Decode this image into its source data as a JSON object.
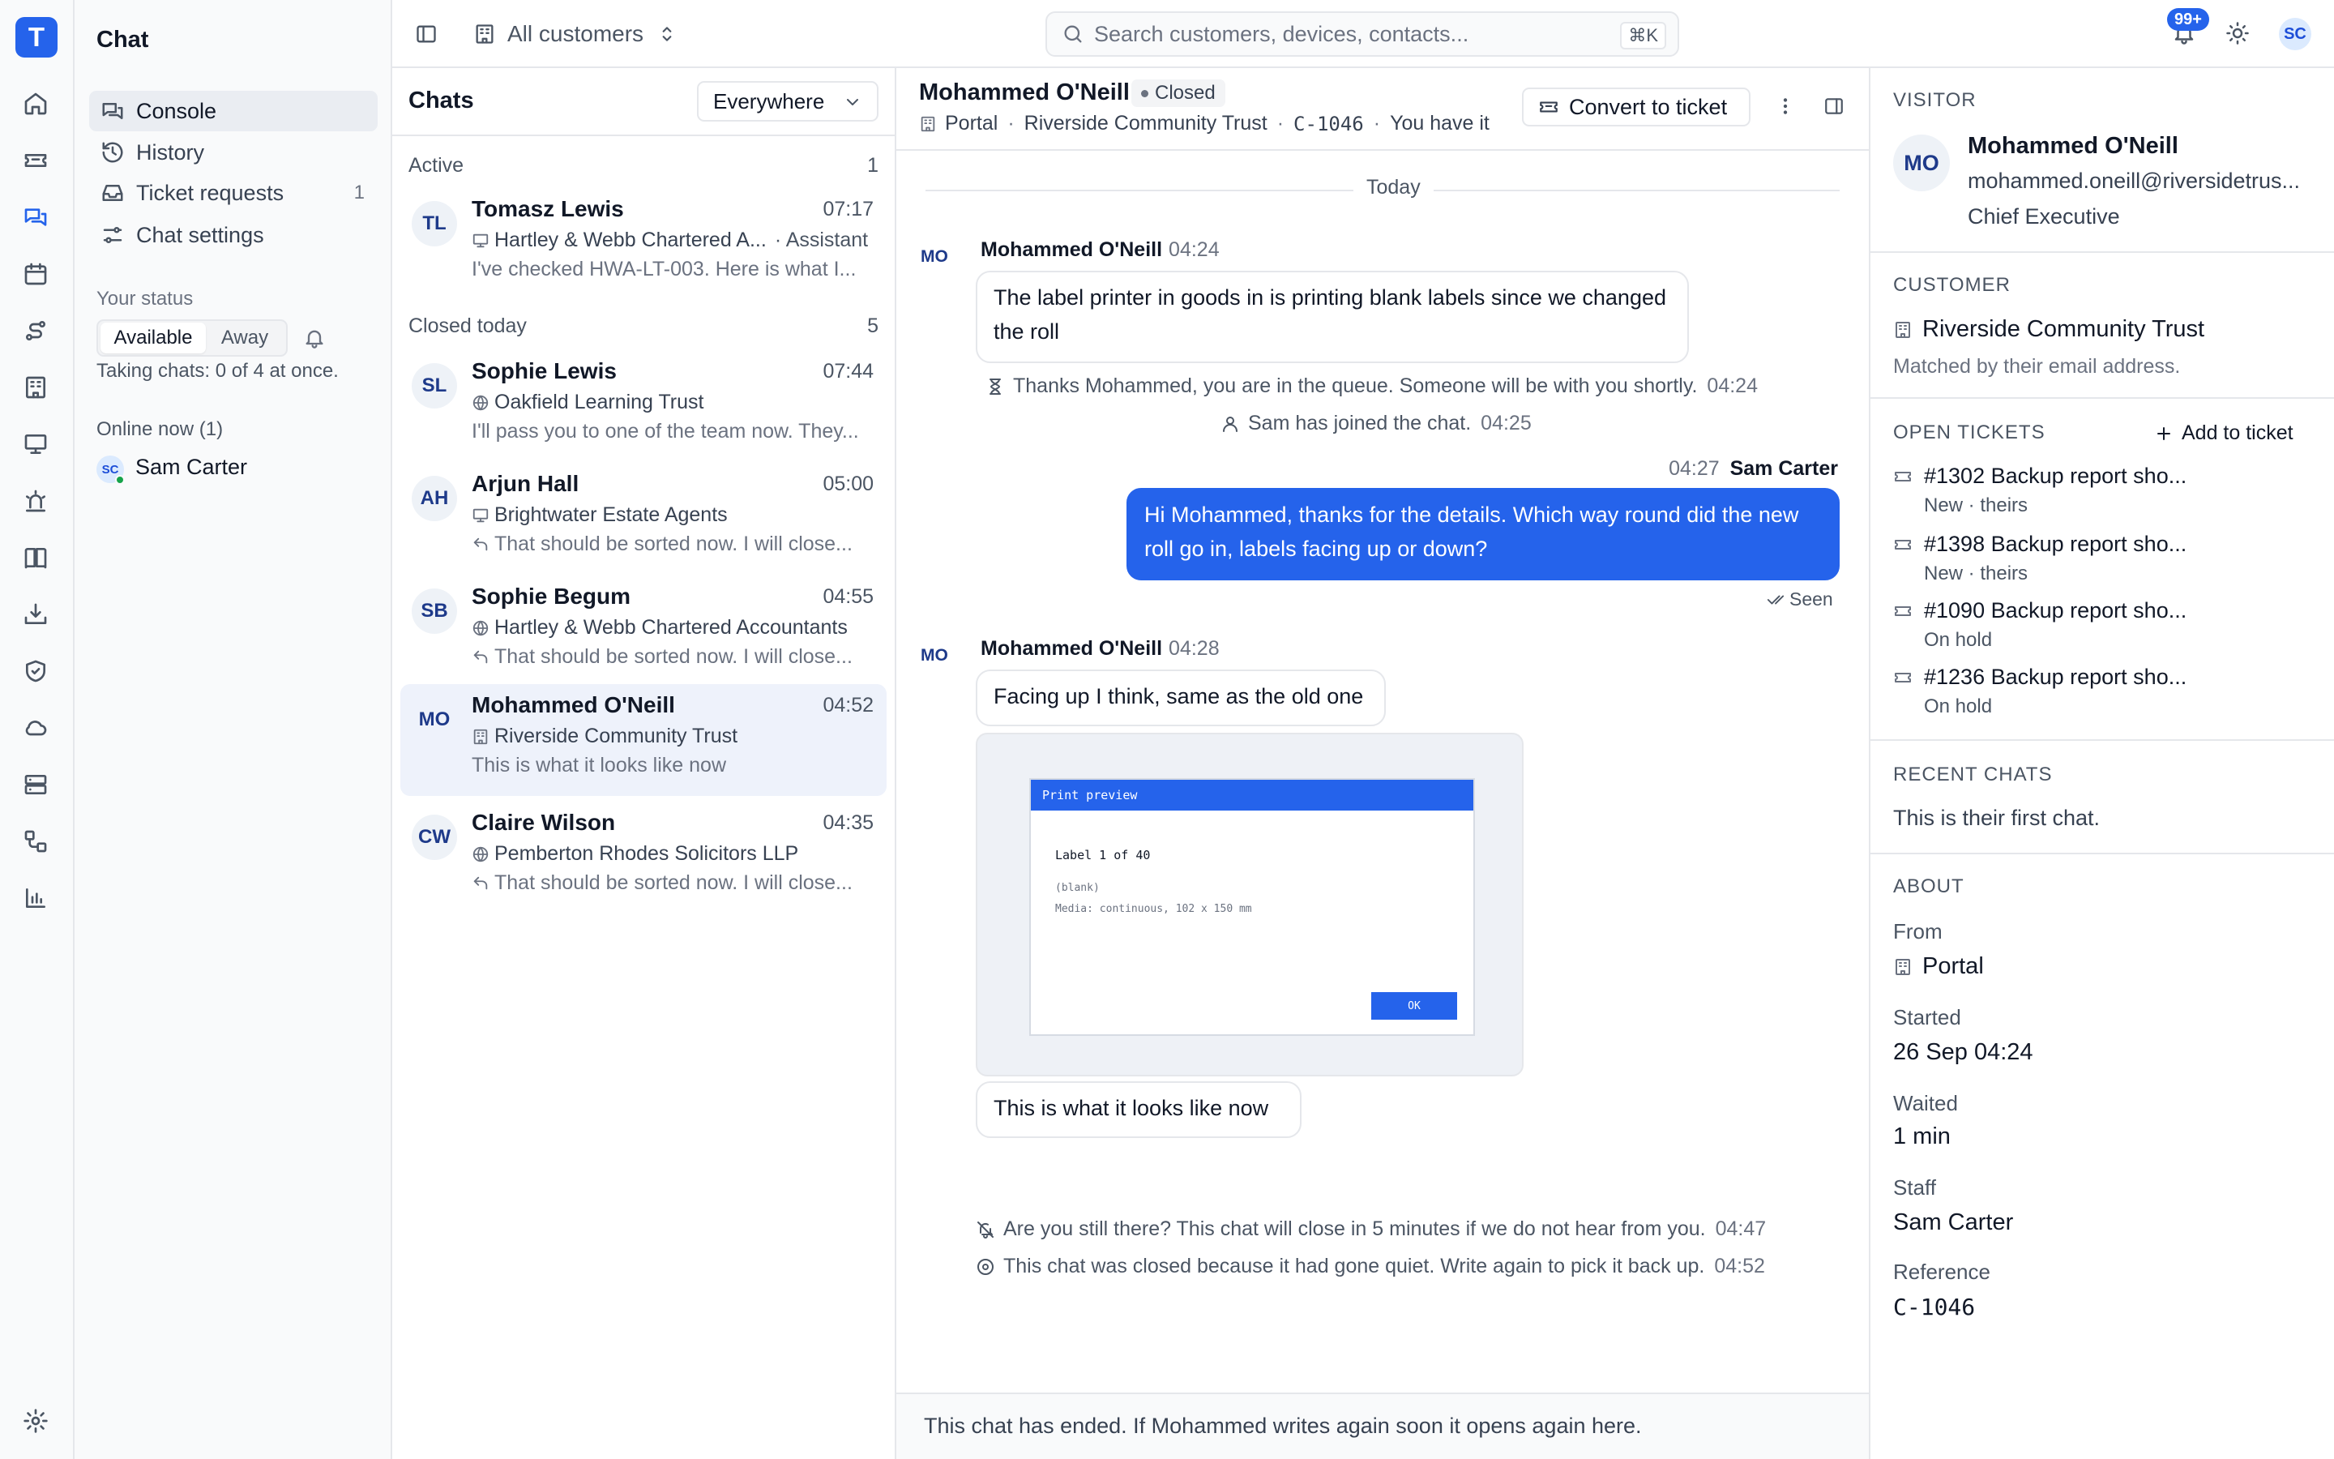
{
  "app": {
    "logo_letter": "T"
  },
  "sidebar": {
    "title": "Chat",
    "nav": [
      {
        "label": "Console",
        "icon": "chat-bubbles-icon",
        "active": true
      },
      {
        "label": "History",
        "icon": "history-icon"
      },
      {
        "label": "Ticket requests",
        "icon": "inbox-icon",
        "count": "1"
      },
      {
        "label": "Chat settings",
        "icon": "sliders-icon"
      }
    ],
    "status_label": "Your status",
    "status_options": [
      "Available",
      "Away"
    ],
    "status_selected": "Available",
    "capacity": "Taking chats: 0 of 4 at once.",
    "online_label": "Online now (1)",
    "online_user": {
      "initials": "SC",
      "name": "Sam Carter"
    }
  },
  "topbar": {
    "customer_filter": "All customers",
    "search_placeholder": "Search customers, devices, contacts...",
    "search_shortcut": "⌘K",
    "notif_badge": "99+",
    "user_initials": "SC"
  },
  "chat_list": {
    "title": "Chats",
    "scope": "Everywhere",
    "groups": [
      {
        "label": "Active",
        "count": "1"
      },
      {
        "label": "Closed today",
        "count": "5"
      }
    ],
    "items": [
      {
        "initials": "TL",
        "name": "Tomasz Lewis",
        "time": "07:17",
        "org": "Hartley & Webb Chartered A...",
        "org_icon": "monitor-icon",
        "extra": "· Assistant",
        "preview": "I've checked HWA-LT-003. Here is what I...",
        "reply": false
      },
      {
        "initials": "SL",
        "name": "Sophie Lewis",
        "time": "07:44",
        "org": "Oakfield Learning Trust",
        "org_icon": "globe-icon",
        "preview": "I'll pass you to one of the team now. They...",
        "reply": false
      },
      {
        "initials": "AH",
        "name": "Arjun Hall",
        "time": "05:00",
        "org": "Brightwater Estate Agents",
        "org_icon": "monitor-icon",
        "preview": "That should be sorted now. I will close...",
        "reply": true
      },
      {
        "initials": "SB",
        "name": "Sophie Begum",
        "time": "04:55",
        "org": "Hartley & Webb Chartered Accountants",
        "org_icon": "globe-icon",
        "preview": "That should be sorted now. I will close...",
        "reply": true
      },
      {
        "initials": "MO",
        "name": "Mohammed O'Neill",
        "time": "04:52",
        "org": "Riverside Community Trust",
        "org_icon": "building-icon",
        "preview": "This is what it looks like now",
        "reply": false,
        "selected": true
      },
      {
        "initials": "CW",
        "name": "Claire Wilson",
        "time": "04:35",
        "org": "Pemberton Rhodes Solicitors LLP",
        "org_icon": "globe-icon",
        "preview": "That should be sorted now. I will close...",
        "reply": true
      }
    ]
  },
  "conversation": {
    "name": "Mohammed O'Neill",
    "status": "Closed",
    "source": "Portal",
    "customer": "Riverside Community Trust",
    "reference": "C-1046",
    "owner_note": "You have it",
    "convert_label": "Convert to ticket",
    "day_label": "Today",
    "messages": {
      "m1_author": "Mohammed O'Neill",
      "m1_time": "04:24",
      "m1_text": "The label printer in goods in is printing blank labels since we changed the roll",
      "sys1_text": "Thanks Mohammed, you are in the queue. Someone will be with you shortly.",
      "sys1_time": "04:24",
      "sys2_text": "Sam has joined the chat.",
      "sys2_time": "04:25",
      "m2_time": "04:27",
      "m2_author": "Sam Carter",
      "m2_text": "Hi Mohammed, thanks for the details. Which way round did the new roll go in, labels facing up or down?",
      "m2_status": "Seen",
      "m3_author": "Mohammed O'Neill",
      "m3_time": "04:28",
      "m3_text": "Facing up I think, same as the old one",
      "m4_text": "This is what it looks like now",
      "sys3_text": "Are you still there? This chat will close in 5 minutes if we do not hear from you.",
      "sys3_time": "04:47",
      "sys4_text": "This chat was closed because it had gone quiet. Write again to pick it back up.",
      "sys4_time": "04:52"
    },
    "attachment": {
      "window_title": "Print preview",
      "line1": "Label 1 of 40",
      "line2": "(blank)",
      "line3": "Media: continuous, 102 x 150 mm",
      "ok": "OK"
    },
    "footer": "This chat has ended. If Mohammed writes again soon it opens again here."
  },
  "details": {
    "visitor_label": "VISITOR",
    "visitor": {
      "initials": "MO",
      "name": "Mohammed O'Neill",
      "email": "mohammed.oneill@riversidetrus...",
      "role": "Chief Executive"
    },
    "customer_label": "CUSTOMER",
    "customer": {
      "name": "Riverside Community Trust",
      "note": "Matched by their email address."
    },
    "tickets_label": "OPEN TICKETS",
    "add_ticket": "Add to ticket",
    "tickets": [
      {
        "title": "#1302 Backup report sho...",
        "status": "New · theirs"
      },
      {
        "title": "#1398 Backup report sho...",
        "status": "New · theirs"
      },
      {
        "title": "#1090 Backup report sho...",
        "status": "On hold"
      },
      {
        "title": "#1236 Backup report sho...",
        "status": "On hold"
      }
    ],
    "recent_label": "RECENT CHATS",
    "recent_text": "This is their first chat.",
    "about_label": "ABOUT",
    "about": {
      "from_k": "From",
      "from_v": "Portal",
      "started_k": "Started",
      "started_v": "26 Sep 04:24",
      "waited_k": "Waited",
      "waited_v": "1 min",
      "staff_k": "Staff",
      "staff_v": "Sam Carter",
      "ref_k": "Reference",
      "ref_v": "C-1046"
    }
  },
  "colors": {
    "accent": "#2563eb",
    "selected_row": "#eef2fb",
    "online": "#16a34a"
  }
}
